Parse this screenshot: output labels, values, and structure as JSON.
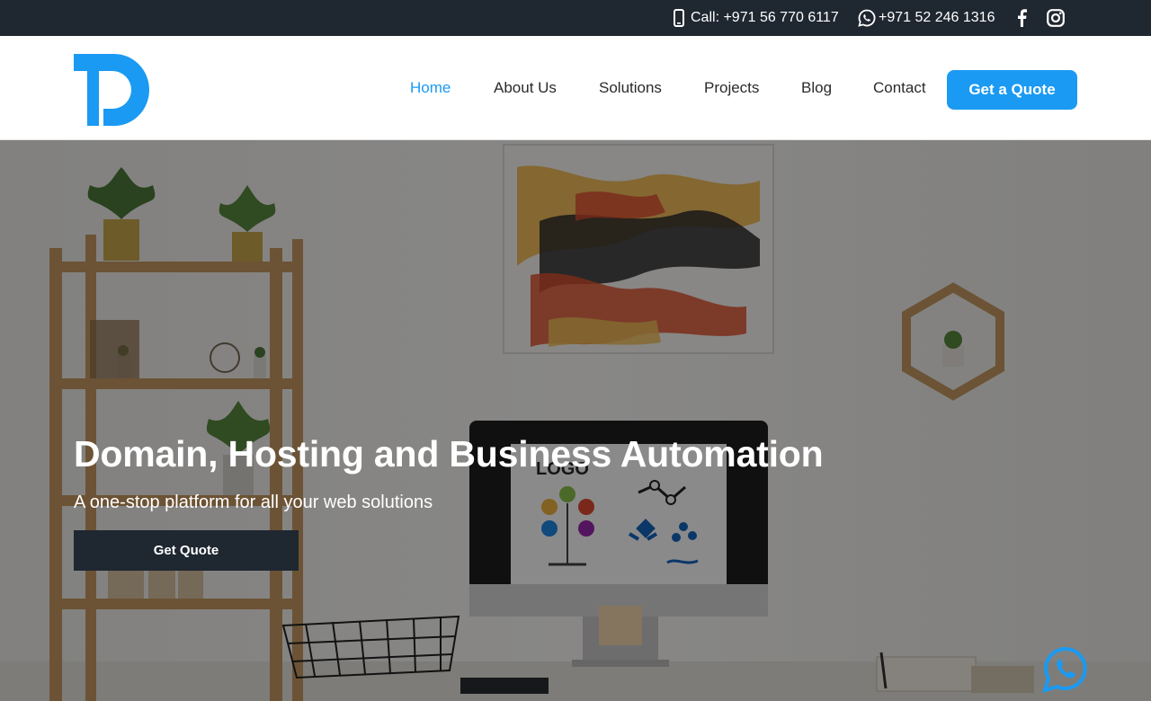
{
  "topbar": {
    "phone_icon": "mobile-phone-icon",
    "call_text": "Call: +971 56 770 6117",
    "whatsapp_icon": "whatsapp-icon",
    "whatsapp_text": "+971 52 246 1316",
    "facebook_icon": "facebook-icon",
    "instagram_icon": "instagram-icon"
  },
  "header": {
    "logo_icon": "td-logo",
    "nav": [
      {
        "label": "Home",
        "active": true
      },
      {
        "label": "About Us",
        "active": false
      },
      {
        "label": "Solutions",
        "active": false
      },
      {
        "label": "Projects",
        "active": false
      },
      {
        "label": "Blog",
        "active": false
      },
      {
        "label": "Contact",
        "active": false
      }
    ],
    "cta_label": "Get a Quote"
  },
  "hero": {
    "title": "Domain, Hosting and Business Automation",
    "subtitle": "A one-stop platform for all your web solutions",
    "button_label": "Get Quote",
    "monitor_screen_text": "LOGO"
  },
  "floating": {
    "whatsapp_icon": "whatsapp-icon"
  },
  "colors": {
    "accent": "#1a9af3",
    "dark": "#1f2731",
    "nav_text": "#2b2b2b"
  }
}
